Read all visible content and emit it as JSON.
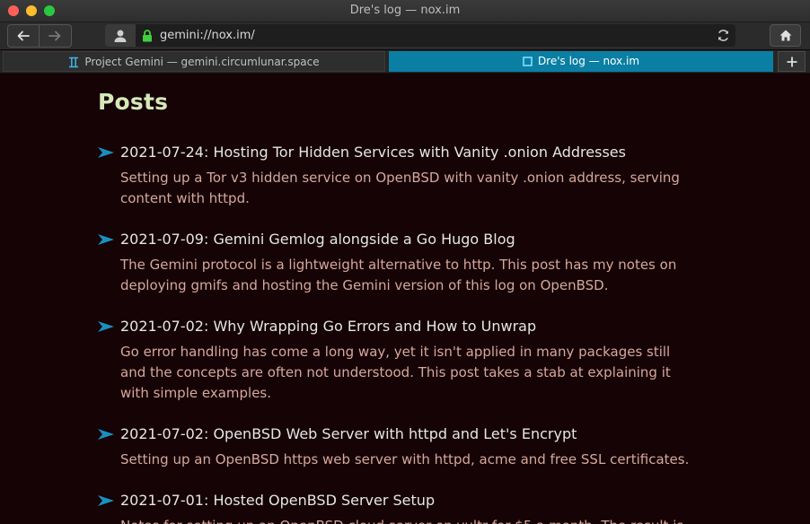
{
  "window": {
    "title": "Dre's log — nox.im"
  },
  "toolbar": {
    "url": "gemini://nox.im/"
  },
  "tabs": [
    {
      "label": "Project Gemini — gemini.circumlunar.space",
      "icon": "gemini-icon",
      "active": false
    },
    {
      "label": "Dre's log — nox.im",
      "icon": "page-icon",
      "active": true
    }
  ],
  "colors": {
    "accent": "#0a7fa3",
    "heading": "#d6e8b8",
    "description": "#d7a89c",
    "background": "#150306"
  },
  "page": {
    "heading": "Posts",
    "posts": [
      {
        "title": "2021-07-24: Hosting Tor Hidden Services with Vanity .onion Addresses",
        "desc": "Setting up a Tor v3 hidden service on OpenBSD with vanity .onion address, serving content with httpd."
      },
      {
        "title": "2021-07-09: Gemini Gemlog alongside a Go Hugo Blog",
        "desc": "The Gemini protocol is a lightweight alternative to http. This post has my notes on deploying gmifs and hosting the Gemini version of this log on OpenBSD."
      },
      {
        "title": "2021-07-02: Why Wrapping Go Errors and How to Unwrap",
        "desc": "Go error handling has come a long way, yet it isn't applied in many packages still and the concepts are often not understood. This post takes a stab at explaining it with simple examples."
      },
      {
        "title": "2021-07-02: OpenBSD Web Server with httpd and Let's Encrypt",
        "desc": "Setting up an OpenBSD https web server with httpd, acme and free SSL certificates."
      },
      {
        "title": "2021-07-01: Hosted OpenBSD Server Setup",
        "desc": "Notes for setting up an OpenBSD cloud server on vultr for $5 a month. The result is"
      }
    ]
  }
}
